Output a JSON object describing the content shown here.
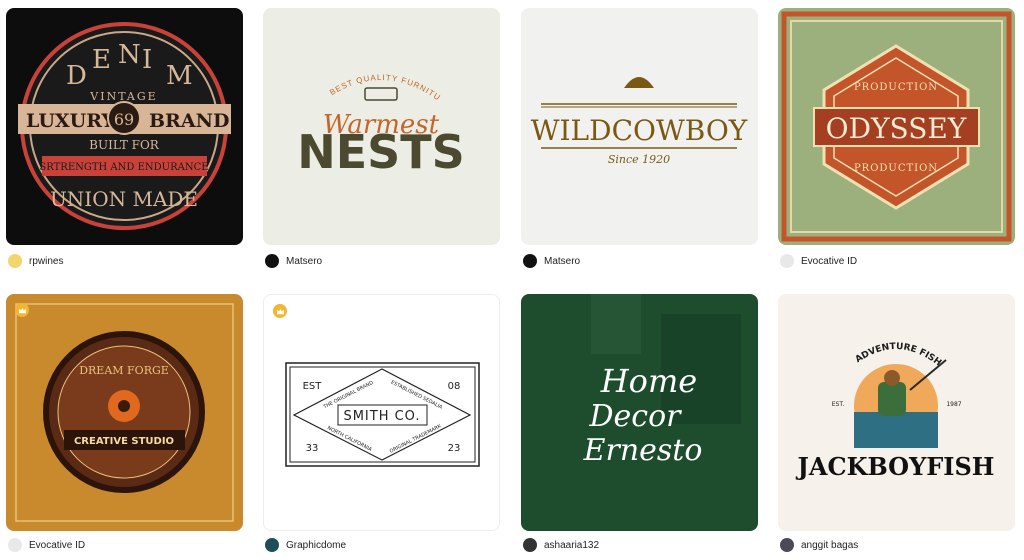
{
  "gallery": {
    "items": [
      {
        "author": "rpwines",
        "logo_text": [
          "D",
          "E",
          "N",
          "I",
          "M",
          "VINTAGE",
          "LUXURY",
          "69",
          "BRAND",
          "BUILT FOR",
          "SRTRENGTH AND ENDURANCE",
          "UNION MADE"
        ]
      },
      {
        "author": "Matsero",
        "logo_text": [
          "BEST QUALITY FURNITURE",
          "Warmest",
          "NESTS"
        ]
      },
      {
        "author": "Matsero",
        "logo_text": [
          "WILDCOWBOY",
          "Since 1920"
        ]
      },
      {
        "author": "Evocative ID",
        "logo_text": [
          "PRODUCTION",
          "ODYSSEY",
          "PRODUCTION"
        ]
      },
      {
        "author": "Evocative ID",
        "logo_text": [
          "DREAM FORGE",
          "CREATIVE STUDIO"
        ]
      },
      {
        "author": "Graphicdome",
        "logo_text": [
          "EST",
          "08",
          "THE ORIGINAL BRAND",
          "ESTABLISHED SEDALIA",
          "SMITH CO.",
          "NORTH CALIFORNIA",
          "ORIGINAL TRADEMARK",
          "33",
          "23"
        ]
      },
      {
        "author": "ashaaria132",
        "logo_text": [
          "Home",
          "Decor",
          "Ernesto"
        ]
      },
      {
        "author": "anggit bagas",
        "logo_text": [
          "ADVENTURE FISHING",
          "EST.",
          "1987",
          "JACKBOYFISH"
        ]
      }
    ]
  },
  "colors": {
    "card1_bg": "#0d0d0d",
    "card2_bg": "#ecede4",
    "card3_bg": "#f1f1f0",
    "card4_bg": "#9bb07d",
    "card5_bg": "#c9892d",
    "card6_bg": "#ffffff",
    "card7_bg": "#1e4d2e",
    "card8_bg": "#f6f1ea",
    "premium_badge": "#f2b632"
  },
  "icons": [
    "crown-icon"
  ]
}
